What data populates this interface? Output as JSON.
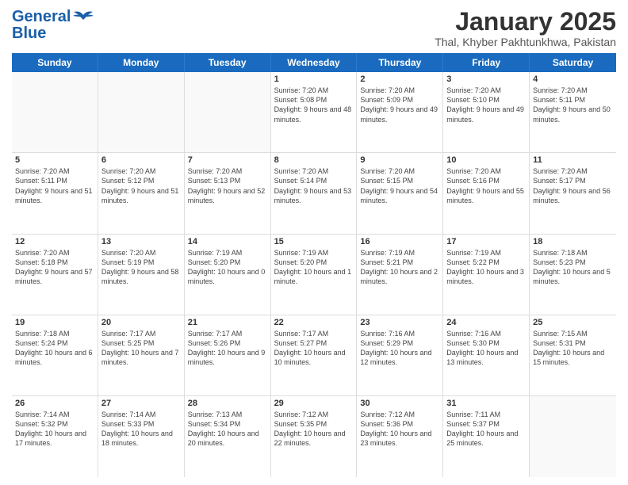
{
  "logo": {
    "line1": "General",
    "line2": "Blue"
  },
  "title": "January 2025",
  "subtitle": "Thal, Khyber Pakhtunkhwa, Pakistan",
  "header_days": [
    "Sunday",
    "Monday",
    "Tuesday",
    "Wednesday",
    "Thursday",
    "Friday",
    "Saturday"
  ],
  "weeks": [
    [
      {
        "day": "",
        "info": ""
      },
      {
        "day": "",
        "info": ""
      },
      {
        "day": "",
        "info": ""
      },
      {
        "day": "1",
        "info": "Sunrise: 7:20 AM\nSunset: 5:08 PM\nDaylight: 9 hours\nand 48 minutes."
      },
      {
        "day": "2",
        "info": "Sunrise: 7:20 AM\nSunset: 5:09 PM\nDaylight: 9 hours\nand 49 minutes."
      },
      {
        "day": "3",
        "info": "Sunrise: 7:20 AM\nSunset: 5:10 PM\nDaylight: 9 hours\nand 49 minutes."
      },
      {
        "day": "4",
        "info": "Sunrise: 7:20 AM\nSunset: 5:11 PM\nDaylight: 9 hours\nand 50 minutes."
      }
    ],
    [
      {
        "day": "5",
        "info": "Sunrise: 7:20 AM\nSunset: 5:11 PM\nDaylight: 9 hours\nand 51 minutes."
      },
      {
        "day": "6",
        "info": "Sunrise: 7:20 AM\nSunset: 5:12 PM\nDaylight: 9 hours\nand 51 minutes."
      },
      {
        "day": "7",
        "info": "Sunrise: 7:20 AM\nSunset: 5:13 PM\nDaylight: 9 hours\nand 52 minutes."
      },
      {
        "day": "8",
        "info": "Sunrise: 7:20 AM\nSunset: 5:14 PM\nDaylight: 9 hours\nand 53 minutes."
      },
      {
        "day": "9",
        "info": "Sunrise: 7:20 AM\nSunset: 5:15 PM\nDaylight: 9 hours\nand 54 minutes."
      },
      {
        "day": "10",
        "info": "Sunrise: 7:20 AM\nSunset: 5:16 PM\nDaylight: 9 hours\nand 55 minutes."
      },
      {
        "day": "11",
        "info": "Sunrise: 7:20 AM\nSunset: 5:17 PM\nDaylight: 9 hours\nand 56 minutes."
      }
    ],
    [
      {
        "day": "12",
        "info": "Sunrise: 7:20 AM\nSunset: 5:18 PM\nDaylight: 9 hours\nand 57 minutes."
      },
      {
        "day": "13",
        "info": "Sunrise: 7:20 AM\nSunset: 5:19 PM\nDaylight: 9 hours\nand 58 minutes."
      },
      {
        "day": "14",
        "info": "Sunrise: 7:19 AM\nSunset: 5:20 PM\nDaylight: 10 hours\nand 0 minutes."
      },
      {
        "day": "15",
        "info": "Sunrise: 7:19 AM\nSunset: 5:20 PM\nDaylight: 10 hours\nand 1 minute."
      },
      {
        "day": "16",
        "info": "Sunrise: 7:19 AM\nSunset: 5:21 PM\nDaylight: 10 hours\nand 2 minutes."
      },
      {
        "day": "17",
        "info": "Sunrise: 7:19 AM\nSunset: 5:22 PM\nDaylight: 10 hours\nand 3 minutes."
      },
      {
        "day": "18",
        "info": "Sunrise: 7:18 AM\nSunset: 5:23 PM\nDaylight: 10 hours\nand 5 minutes."
      }
    ],
    [
      {
        "day": "19",
        "info": "Sunrise: 7:18 AM\nSunset: 5:24 PM\nDaylight: 10 hours\nand 6 minutes."
      },
      {
        "day": "20",
        "info": "Sunrise: 7:17 AM\nSunset: 5:25 PM\nDaylight: 10 hours\nand 7 minutes."
      },
      {
        "day": "21",
        "info": "Sunrise: 7:17 AM\nSunset: 5:26 PM\nDaylight: 10 hours\nand 9 minutes."
      },
      {
        "day": "22",
        "info": "Sunrise: 7:17 AM\nSunset: 5:27 PM\nDaylight: 10 hours\nand 10 minutes."
      },
      {
        "day": "23",
        "info": "Sunrise: 7:16 AM\nSunset: 5:29 PM\nDaylight: 10 hours\nand 12 minutes."
      },
      {
        "day": "24",
        "info": "Sunrise: 7:16 AM\nSunset: 5:30 PM\nDaylight: 10 hours\nand 13 minutes."
      },
      {
        "day": "25",
        "info": "Sunrise: 7:15 AM\nSunset: 5:31 PM\nDaylight: 10 hours\nand 15 minutes."
      }
    ],
    [
      {
        "day": "26",
        "info": "Sunrise: 7:14 AM\nSunset: 5:32 PM\nDaylight: 10 hours\nand 17 minutes."
      },
      {
        "day": "27",
        "info": "Sunrise: 7:14 AM\nSunset: 5:33 PM\nDaylight: 10 hours\nand 18 minutes."
      },
      {
        "day": "28",
        "info": "Sunrise: 7:13 AM\nSunset: 5:34 PM\nDaylight: 10 hours\nand 20 minutes."
      },
      {
        "day": "29",
        "info": "Sunrise: 7:12 AM\nSunset: 5:35 PM\nDaylight: 10 hours\nand 22 minutes."
      },
      {
        "day": "30",
        "info": "Sunrise: 7:12 AM\nSunset: 5:36 PM\nDaylight: 10 hours\nand 23 minutes."
      },
      {
        "day": "31",
        "info": "Sunrise: 7:11 AM\nSunset: 5:37 PM\nDaylight: 10 hours\nand 25 minutes."
      },
      {
        "day": "",
        "info": ""
      }
    ]
  ]
}
